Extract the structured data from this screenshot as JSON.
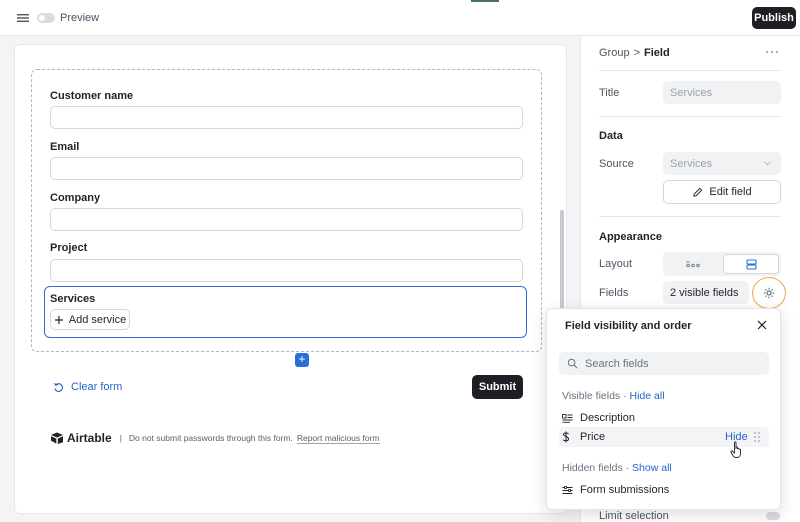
{
  "topbar": {
    "menu_icon": "hamburger-menu-icon",
    "preview_label": "Preview",
    "publish_label": "Publish"
  },
  "form": {
    "fields": [
      {
        "label": "Customer name"
      },
      {
        "label": "Email"
      },
      {
        "label": "Company"
      },
      {
        "label": "Project"
      }
    ],
    "services": {
      "label": "Services",
      "add_label": "Add service"
    },
    "clear_label": "Clear form",
    "submit_label": "Submit"
  },
  "footer": {
    "brand": "Airtable",
    "separator": "|",
    "notice": "Do not submit passwords through this form.",
    "report_link": "Report malicious form"
  },
  "panel": {
    "breadcrumb": {
      "parent": "Group",
      "separator": ">",
      "current": "Field"
    },
    "more": "···",
    "title_label": "Title",
    "title_value": "Services",
    "data_heading": "Data",
    "source_label": "Source",
    "source_value": "Services",
    "edit_field_label": "Edit field",
    "appearance_heading": "Appearance",
    "layout_label": "Layout",
    "fields_label": "Fields",
    "fields_value": "2 visible fields",
    "limit_label": "Limit selection"
  },
  "popup": {
    "title": "Field visibility and order",
    "search_placeholder": "Search fields",
    "visible_label": "Visible fields",
    "dot": "·",
    "hide_all": "Hide all",
    "visible_fields": [
      {
        "name": "Description",
        "icon": "long-text-icon"
      },
      {
        "name": "Price",
        "icon": "currency-icon",
        "action": "Hide"
      }
    ],
    "hidden_label": "Hidden fields",
    "show_all": "Show all",
    "hidden_fields": [
      {
        "name": "Form submissions",
        "icon": "linked-record-icon"
      }
    ]
  },
  "colors": {
    "accent_blue": "#2b6fd6",
    "link_blue": "#2563c9",
    "dark_button": "#1d1f25",
    "highlight_orange": "#f0a44a"
  }
}
